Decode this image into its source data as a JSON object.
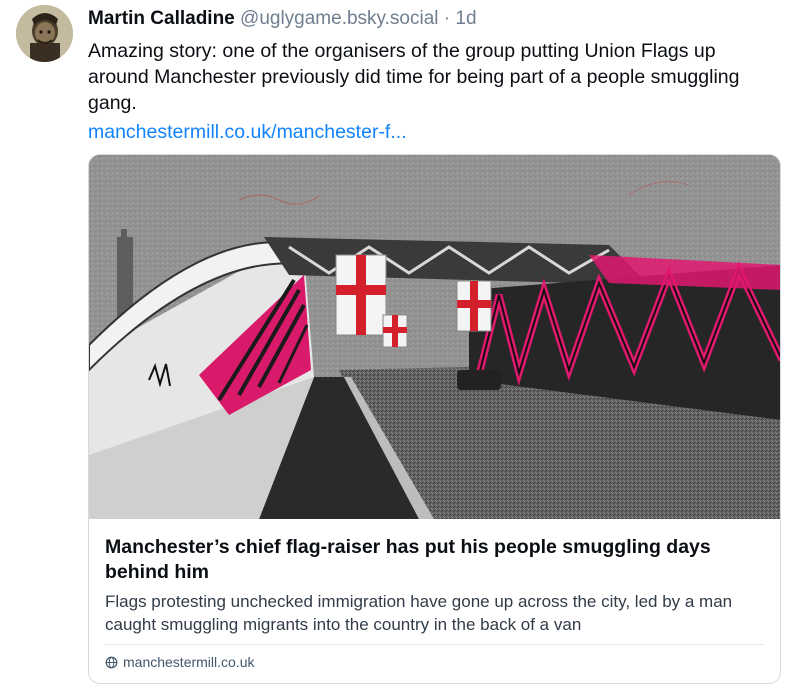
{
  "post": {
    "author": {
      "display_name": "Martin Calladine",
      "handle": "@uglygame.bsky.social",
      "separator": "·",
      "timestamp": "1d"
    },
    "text": "Amazing story: one of the organisers of the group putting Union Flags up around Manchester previously did time for being part of a people smuggling gang.",
    "link_text": "manchestermill.co.uk/manchester-f..."
  },
  "link_card": {
    "title": "Manchester’s chief flag-raiser has put his people smuggling days behind him",
    "description": "Flags protesting unchecked immigration have gone up across the city, led by a man caught smuggling migrants into the country in the back of a van",
    "domain": "manchestermill.co.uk",
    "domain_icon": "globe-icon"
  },
  "colors": {
    "link": "#1083fe",
    "muted": "#6f7e8f",
    "accent_magenta": "#e0186e",
    "flag_red": "#d4202a"
  }
}
